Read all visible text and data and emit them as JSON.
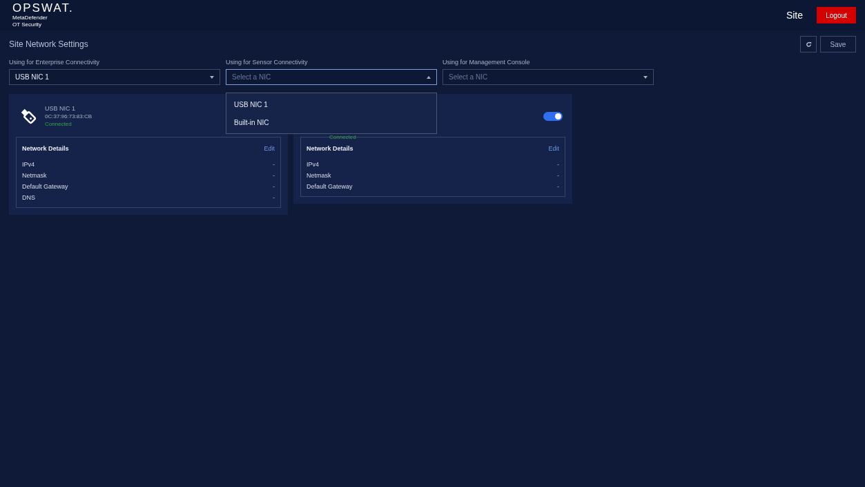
{
  "header": {
    "logo": "OPSWAT.",
    "product_line1": "MetaDefender",
    "product_line2": "OT Security",
    "site": "Site",
    "logout": "Logout"
  },
  "page": {
    "title": "Site Network Settings",
    "save": "Save"
  },
  "selects": [
    {
      "label": "Using for Enterprise Connectivity",
      "value": "USB NIC 1",
      "open": false
    },
    {
      "label": "Using for Sensor Connectivity",
      "placeholder": "Select a NIC",
      "open": true,
      "options": [
        {
          "label": "USB NIC 1",
          "selected": false
        },
        {
          "label": "Built-in NIC",
          "selected": false
        }
      ]
    },
    {
      "label": "Using for Management Console",
      "placeholder": "Select a NIC",
      "open": false
    }
  ],
  "cards": [
    {
      "name": "USB NIC 1",
      "mac": "0C:37:96:73:83:CB",
      "status": "Connected",
      "details_title": "Network Details",
      "edit": "Edit",
      "rows": [
        {
          "label": "IPv4",
          "value": "-"
        },
        {
          "label": "Netmask",
          "value": "-"
        },
        {
          "label": "Default Gateway",
          "value": "-"
        },
        {
          "label": "DNS",
          "value": "-"
        }
      ]
    },
    {
      "status": "Connected",
      "enabled": true,
      "details_title": "Network Details",
      "edit": "Edit",
      "rows": [
        {
          "label": "IPv4",
          "value": "-"
        },
        {
          "label": "Netmask",
          "value": "-"
        },
        {
          "label": "Default Gateway",
          "value": "-"
        }
      ]
    }
  ]
}
